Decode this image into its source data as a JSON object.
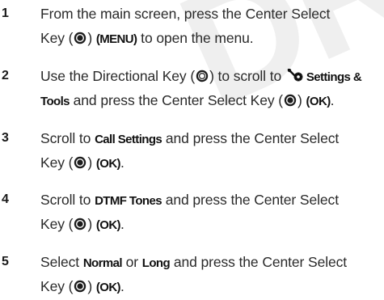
{
  "watermark": "DR",
  "steps": [
    {
      "number": "1",
      "line1": [
        "From the main screen, press the Center Select"
      ],
      "line2": [
        "Key (",
        "icon:center-key",
        ") ",
        "b:(MENU)",
        " to open the menu."
      ]
    },
    {
      "number": "2",
      "line1": [
        "Use the Directional Key (",
        "icon:directional-key",
        ") to scroll to ",
        "icon:settings-gear",
        "b:Settings &"
      ],
      "line2": [
        "b:Tools",
        " and press the Center Select Key (",
        "icon:center-key",
        ") ",
        "b:(OK)",
        "."
      ]
    },
    {
      "number": "3",
      "line1": [
        "Scroll to ",
        "b:Call Settings",
        " and press the Center Select"
      ],
      "line2": [
        "Key (",
        "icon:center-key",
        ") ",
        "b:(OK)",
        "."
      ]
    },
    {
      "number": "4",
      "line1": [
        "Scroll to ",
        "b:DTMF Tones",
        " and press the Center Select"
      ],
      "line2": [
        "Key (",
        "icon:center-key",
        ") ",
        "b:(OK)",
        "."
      ]
    },
    {
      "number": "5",
      "line1": [
        "Select ",
        "b:Normal",
        " or ",
        "b:Long",
        " and press the Center Select"
      ],
      "line2": [
        "Key (",
        "icon:center-key",
        ") ",
        "b:(OK)",
        "."
      ]
    }
  ],
  "icons": {
    "center-key": "center-select-key-icon",
    "directional-key": "directional-key-icon",
    "settings-gear": "settings-gear-icon"
  }
}
